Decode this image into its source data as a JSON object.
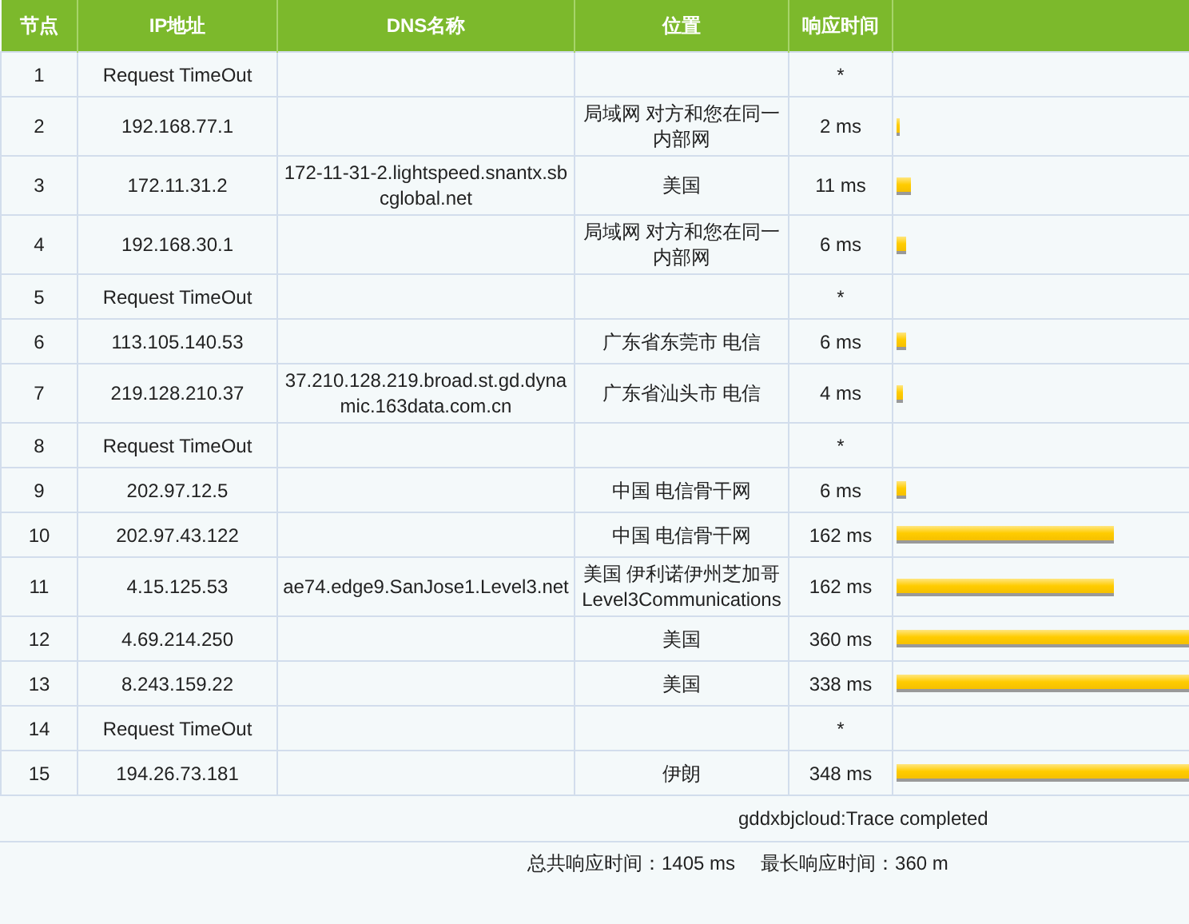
{
  "table": {
    "columns": [
      "节点",
      "IP地址",
      "DNS名称",
      "位置",
      "响应时间"
    ],
    "rows": [
      {
        "hop": "1",
        "ip": "Request TimeOut",
        "time": "*"
      },
      {
        "hop": "2",
        "ip": "192.168.77.1",
        "location": "局域网 对方和您在同一内部网",
        "time": "2 ms",
        "level": 0.01
      },
      {
        "hop": "3",
        "ip": "172.11.31.2",
        "dns": "172-11-31-2.lightspeed.snantx.sbcglobal.net",
        "location": "美国",
        "time": "11 ms",
        "level": 0.05
      },
      {
        "hop": "4",
        "ip": "192.168.30.1",
        "location": "局域网 对方和您在同一内部网",
        "time": "6 ms",
        "level": 0.03
      },
      {
        "hop": "5",
        "ip": "Request TimeOut",
        "time": "*"
      },
      {
        "hop": "6",
        "ip": "113.105.140.53",
        "location": "广东省东莞市 电信",
        "time": "6 ms",
        "level": 0.03
      },
      {
        "hop": "7",
        "ip": "219.128.210.37",
        "dns": "37.210.128.219.broad.st.gd.dynamic.163data.com.cn",
        "location": "广东省汕头市 电信",
        "time": "4 ms",
        "level": 0.02
      },
      {
        "hop": "8",
        "ip": "Request TimeOut",
        "time": "*"
      },
      {
        "hop": "9",
        "ip": "202.97.12.5",
        "location": "中国 电信骨干网",
        "time": "6 ms",
        "level": 0.03
      },
      {
        "hop": "10",
        "ip": "202.97.43.122",
        "location": "中国 电信骨干网",
        "time": "162 ms",
        "level": 0.73
      },
      {
        "hop": "11",
        "ip": "4.15.125.53",
        "dns": "ae74.edge9.SanJose1.Level3.net",
        "location": "美国 伊利诺伊州芝加哥Level3Communications",
        "time": "162 ms",
        "level": 0.73
      },
      {
        "hop": "12",
        "ip": "4.69.214.250",
        "location": "美国",
        "time": "360 ms",
        "level": 1
      },
      {
        "hop": "13",
        "ip": "8.243.159.22",
        "location": "美国",
        "time": "338 ms",
        "level": 1
      },
      {
        "hop": "14",
        "ip": "Request TimeOut",
        "time": "*"
      },
      {
        "hop": "15",
        "ip": "194.26.73.181",
        "location": "伊朗",
        "time": "348 ms",
        "level": 1
      }
    ]
  },
  "footer": {
    "status": "gddxbjcloud:Trace completed",
    "total": "总共响应时间：1405 ms",
    "max": "最长响应时间：360 m"
  }
}
